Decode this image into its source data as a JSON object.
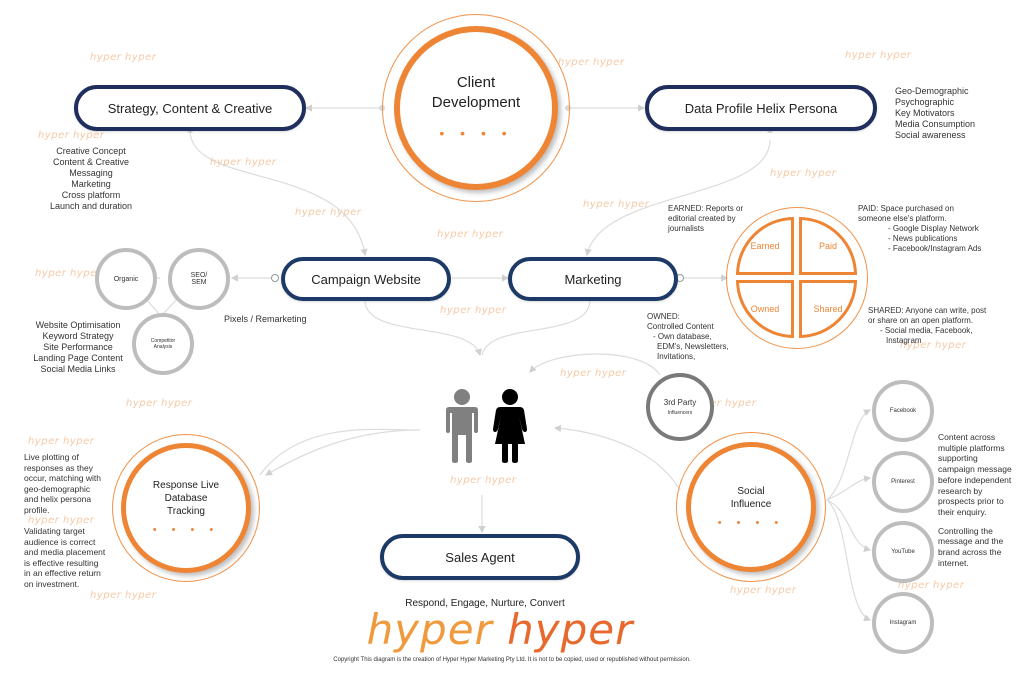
{
  "center": {
    "label_line1": "Client",
    "label_line2": "Development",
    "dots": "• • • •"
  },
  "nodes": {
    "strategy": "Strategy, Content & Creative",
    "data_profile": "Data Profile Helix Persona",
    "campaign_website": "Campaign Website",
    "marketing": "Marketing",
    "sales_agent": "Sales Agent"
  },
  "strategy_notes": [
    "Creative Concept",
    "Content & Creative",
    "Messaging",
    "Marketing",
    "Cross platform",
    "Launch and duration"
  ],
  "profile_notes": [
    "Geo-Demographic",
    "Psychographic",
    "Key Motivators",
    "Media Consumption",
    "Social awareness"
  ],
  "website_circles": {
    "organic": "Organic",
    "seo_line1": "SEO/",
    "seo_line2": "SEM",
    "competitor_line1": "Competitor",
    "competitor_line2": "Analysis"
  },
  "website_notes": [
    "Website Optimisation",
    "Keyword Strategy",
    "Site Performance",
    "Landing Page Content",
    "Social Media Links"
  ],
  "pixels_label": "Pixels / Remarketing",
  "media_quadrants": {
    "earned": "Earned",
    "paid": "Paid",
    "owned": "Owned",
    "shared": "Shared"
  },
  "earned_note": [
    "EARNED: Reports or",
    "editorial created by",
    "journalists"
  ],
  "paid_note": {
    "lines": [
      "PAID: Space purchased on",
      "someone else's platform."
    ],
    "items": [
      "- Google Display Network",
      "- News publications",
      "- Facebook/Instagram Ads"
    ]
  },
  "owned_note": {
    "lines": [
      "OWNED:",
      "Controlled Content"
    ],
    "items": [
      "- Own database,",
      "EDM's, Newsletters,",
      "Invitations,"
    ]
  },
  "shared_note": {
    "lines": [
      "SHARED:  Anyone can write, post",
      "or share on an open platform."
    ],
    "items": [
      "- Social media, Facebook,",
      "Instagram"
    ]
  },
  "third_party": {
    "line1": "3rd Party",
    "line2": "Influencers"
  },
  "response": {
    "line1": "Response Live",
    "line2": "Database",
    "line3": "Tracking",
    "dots": "• • • •"
  },
  "response_notes": {
    "p1": [
      "Live plotting of",
      "responses as they",
      "occur, matching with",
      "geo-demographic",
      "and helix persona",
      "profile."
    ],
    "p2": [
      "Validating target",
      "audience is correct",
      "and media placement",
      "is effective resulting",
      "in an effective return",
      "on investment."
    ]
  },
  "social": {
    "line1": "Social",
    "line2": "Influence",
    "dots": "• • • •"
  },
  "social_platforms": [
    "Facebook",
    "Pinterest",
    "YouTube",
    "Instagram"
  ],
  "social_notes": {
    "p1": [
      "Content across",
      "multiple platforms",
      "supporting",
      "campaign message",
      "before independent",
      "research by",
      "prospects prior to",
      "their enquiry."
    ],
    "p2": [
      "Controlling the",
      "message and the",
      "brand across the",
      "internet."
    ]
  },
  "tagline": "Respond, Engage, Nurture, Convert",
  "logo": {
    "word1": "hyper",
    "word2": "hyper"
  },
  "watermark": "hyper hyper",
  "copyright": "Copyright This diagram is the creation of Hyper Hyper Marketing Pty Ltd.  It is not to be copied, used or republished without permission.",
  "colors": {
    "orange": "#ee8535",
    "navy": "#1f2e5c",
    "gray": "#bdbdbd"
  }
}
